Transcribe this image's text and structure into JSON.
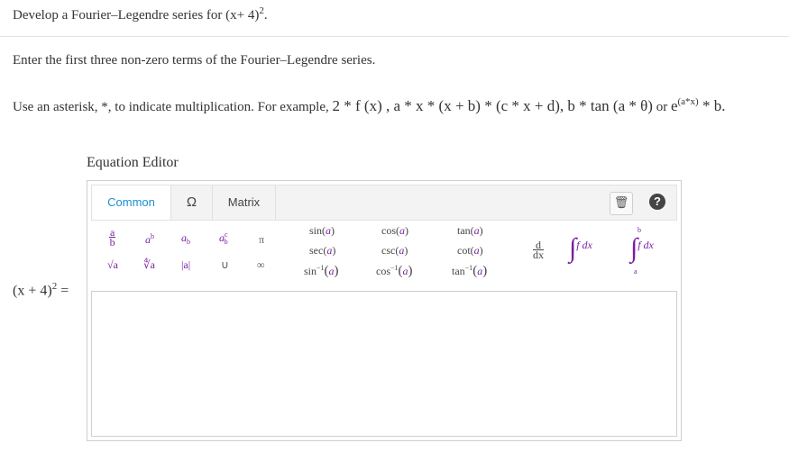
{
  "question": {
    "line1_prefix": "Develop a Fourier–Legendre series for ",
    "line1_math": "(x+ 4)",
    "line1_exp": "2",
    "line1_suffix": ".",
    "line2": "Enter the first three non-zero terms of the Fourier–Legendre series.",
    "line3_prefix": "Use an asterisk, *, to indicate multiplication. For example, ",
    "line3_examples": "2 * f (x) , a * x * (x + b) * (c * x + d),   b * tan (a * θ)",
    "line3_or": " or ",
    "line3_e": "e",
    "line3_e_exp": "(a*x)",
    "line3_tail": " * b."
  },
  "editor": {
    "title": "Equation Editor",
    "tabs": [
      "Common",
      "Ω",
      "Matrix"
    ],
    "trash_icon": "trash-icon",
    "help_icon": "help-icon",
    "help_glyph": "?",
    "trash_glyph": "🗑",
    "palette": {
      "frac_top": "a",
      "frac_bot": "b",
      "power_base": "a",
      "power_exp": "b",
      "sub_base": "a",
      "sub_idx": "b",
      "subsup_base": "a",
      "subsup_sup": "c",
      "subsup_sub": "b",
      "pi": "π",
      "sqrt": "√a",
      "nroot": "∜a",
      "abs": "|a|",
      "union": "∪",
      "infinity": "∞",
      "trig": [
        [
          "sin(",
          "a",
          ")"
        ],
        [
          "cos(",
          "a",
          ")"
        ],
        [
          "tan(",
          "a",
          ")"
        ],
        [
          "sec(",
          "a",
          ")"
        ],
        [
          "csc(",
          "a",
          ")"
        ],
        [
          "cot(",
          "a",
          ")"
        ]
      ],
      "inv": [
        [
          "sin",
          "−1",
          "a"
        ],
        [
          "cos",
          "−1",
          "a"
        ],
        [
          "tan",
          "−1",
          "a"
        ]
      ],
      "deriv_top": "d",
      "deriv_bot": "dx",
      "integral": "∫",
      "integrand": "f dx",
      "def_upper": "b",
      "def_lower": "a"
    }
  },
  "answer": {
    "lhs": "(x + 4)",
    "lhs_exp": "2",
    "lhs_eq": " =",
    "value": ""
  }
}
